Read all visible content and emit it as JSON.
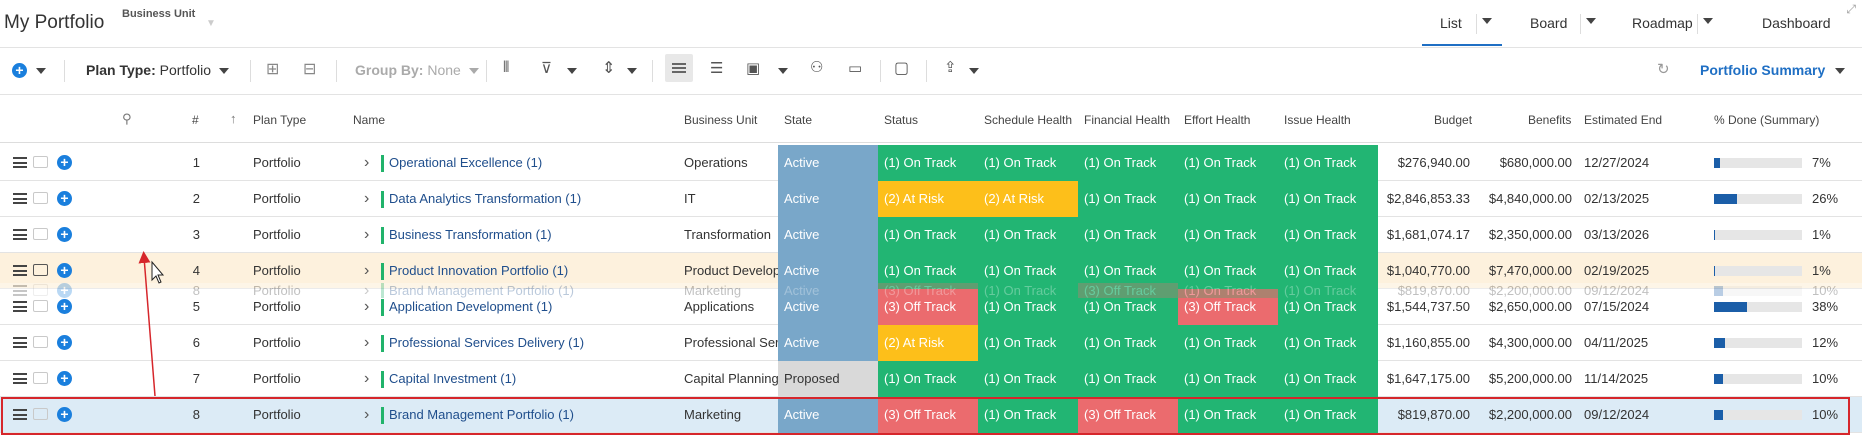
{
  "header": {
    "title": "My Portfolio",
    "business_unit_label": "Business Unit",
    "views": [
      {
        "label": "List"
      },
      {
        "label": "Board"
      },
      {
        "label": "Roadmap"
      },
      {
        "label": "Dashboard"
      }
    ]
  },
  "toolbar": {
    "plan_type_label": "Plan Type:",
    "plan_type_value": "Portfolio",
    "group_by_label": "Group By:",
    "group_by_value": "None",
    "portfolio_summary": "Portfolio Summary"
  },
  "columns": [
    "#",
    "Plan Type",
    "Name",
    "Business Unit",
    "State",
    "Status",
    "Schedule Health",
    "Financial Health",
    "Effort Health",
    "Issue Health",
    "Budget",
    "Benefits",
    "Estimated End",
    "% Done (Summary)"
  ],
  "colors": {
    "active": "#79a7c9",
    "on_track": "#22b573",
    "at_risk": "#fdbf1a",
    "off_track": "#eb6b6e",
    "proposed": "#d9d9d9",
    "progress": "#1b5ea8",
    "drag_row": "#fdf1dd",
    "selected_row": "#dcebf6",
    "selection_outline": "#d6262b"
  },
  "rows": [
    {
      "num": "1",
      "plan_type": "Portfolio",
      "name": "Operational Excellence (1)",
      "bu": "Operations",
      "state": "Active",
      "status": "(1) On Track",
      "schedule": "(1) On Track",
      "financial": "(1) On Track",
      "effort": "(1) On Track",
      "issue": "(1) On Track",
      "budget": "$276,940.00",
      "benefits": "$680,000.00",
      "end": "12/27/2024",
      "pct": "7%",
      "done": 0.07
    },
    {
      "num": "2",
      "plan_type": "Portfolio",
      "name": "Data Analytics Transformation (1)",
      "bu": "IT",
      "state": "Active",
      "status": "(2) At Risk",
      "schedule": "(2) At Risk",
      "financial": "(1) On Track",
      "effort": "(1) On Track",
      "issue": "(1) On Track",
      "budget": "$2,846,853.33",
      "benefits": "$4,840,000.00",
      "end": "02/13/2025",
      "pct": "26%",
      "done": 0.26
    },
    {
      "num": "3",
      "plan_type": "Portfolio",
      "name": "Business Transformation (1)",
      "bu": "Transformation",
      "state": "Active",
      "status": "(1) On Track",
      "schedule": "(1) On Track",
      "financial": "(1) On Track",
      "effort": "(1) On Track",
      "issue": "(1) On Track",
      "budget": "$1,681,074.17",
      "benefits": "$2,350,000.00",
      "end": "03/13/2026",
      "pct": "1%",
      "done": 0.01
    },
    {
      "num": "4",
      "plan_type": "Portfolio",
      "name": "Product Innovation Portfolio (1)",
      "bu": "Product Develop",
      "state": "Active",
      "status": "(1) On Track",
      "schedule": "(1) On Track",
      "financial": "(1) On Track",
      "effort": "(1) On Track",
      "issue": "(1) On Track",
      "budget": "$1,040,770.00",
      "benefits": "$7,470,000.00",
      "end": "02/19/2025",
      "pct": "1%",
      "done": 0.01
    },
    {
      "num": "5",
      "plan_type": "Portfolio",
      "name": "Application Development (1)",
      "bu": "Applications",
      "state": "Active",
      "status": "(3) Off Track",
      "schedule": "(1) On Track",
      "financial": "(1) On Track",
      "effort": "(3) Off Track",
      "issue": "(1) On Track",
      "budget": "$1,544,737.50",
      "benefits": "$2,650,000.00",
      "end": "07/15/2024",
      "pct": "38%",
      "done": 0.38
    },
    {
      "num": "6",
      "plan_type": "Portfolio",
      "name": "Professional Services Delivery (1)",
      "bu": "Professional Ser",
      "state": "Active",
      "status": "(2) At Risk",
      "schedule": "(1) On Track",
      "financial": "(1) On Track",
      "effort": "(1) On Track",
      "issue": "(1) On Track",
      "budget": "$1,160,855.00",
      "benefits": "$4,300,000.00",
      "end": "04/11/2025",
      "pct": "12%",
      "done": 0.12
    },
    {
      "num": "7",
      "plan_type": "Portfolio",
      "name": "Capital Investment (1)",
      "bu": "Capital Planning",
      "state": "Proposed",
      "status": "(1) On Track",
      "schedule": "(1) On Track",
      "financial": "(1) On Track",
      "effort": "(1) On Track",
      "issue": "(1) On Track",
      "budget": "$1,647,175.00",
      "benefits": "$5,200,000.00",
      "end": "11/14/2025",
      "pct": "10%",
      "done": 0.1
    },
    {
      "num": "8",
      "plan_type": "Portfolio",
      "name": "Brand Management Portfolio (1)",
      "bu": "Marketing",
      "state": "Active",
      "status": "(3) Off Track",
      "schedule": "(1) On Track",
      "financial": "(3) Off Track",
      "effort": "(1) On Track",
      "issue": "(1) On Track",
      "budget": "$819,870.00",
      "benefits": "$2,200,000.00",
      "end": "09/12/2024",
      "pct": "10%",
      "done": 0.1
    }
  ],
  "drag_ghost": {
    "num": "8",
    "plan_type": "Portfolio",
    "name": "Brand Management Portfolio (1)",
    "bu": "Marketing",
    "state": "Active",
    "status": "(3) Off Track",
    "schedule": "(1) On Track",
    "financial": "(3) Off Track",
    "effort": "(1) On Track",
    "issue": "(1) On Track",
    "budget": "$819,870.00",
    "benefits": "$2,200,000.00",
    "end": "09/12/2024",
    "pct": "10%",
    "done": 0.1
  }
}
